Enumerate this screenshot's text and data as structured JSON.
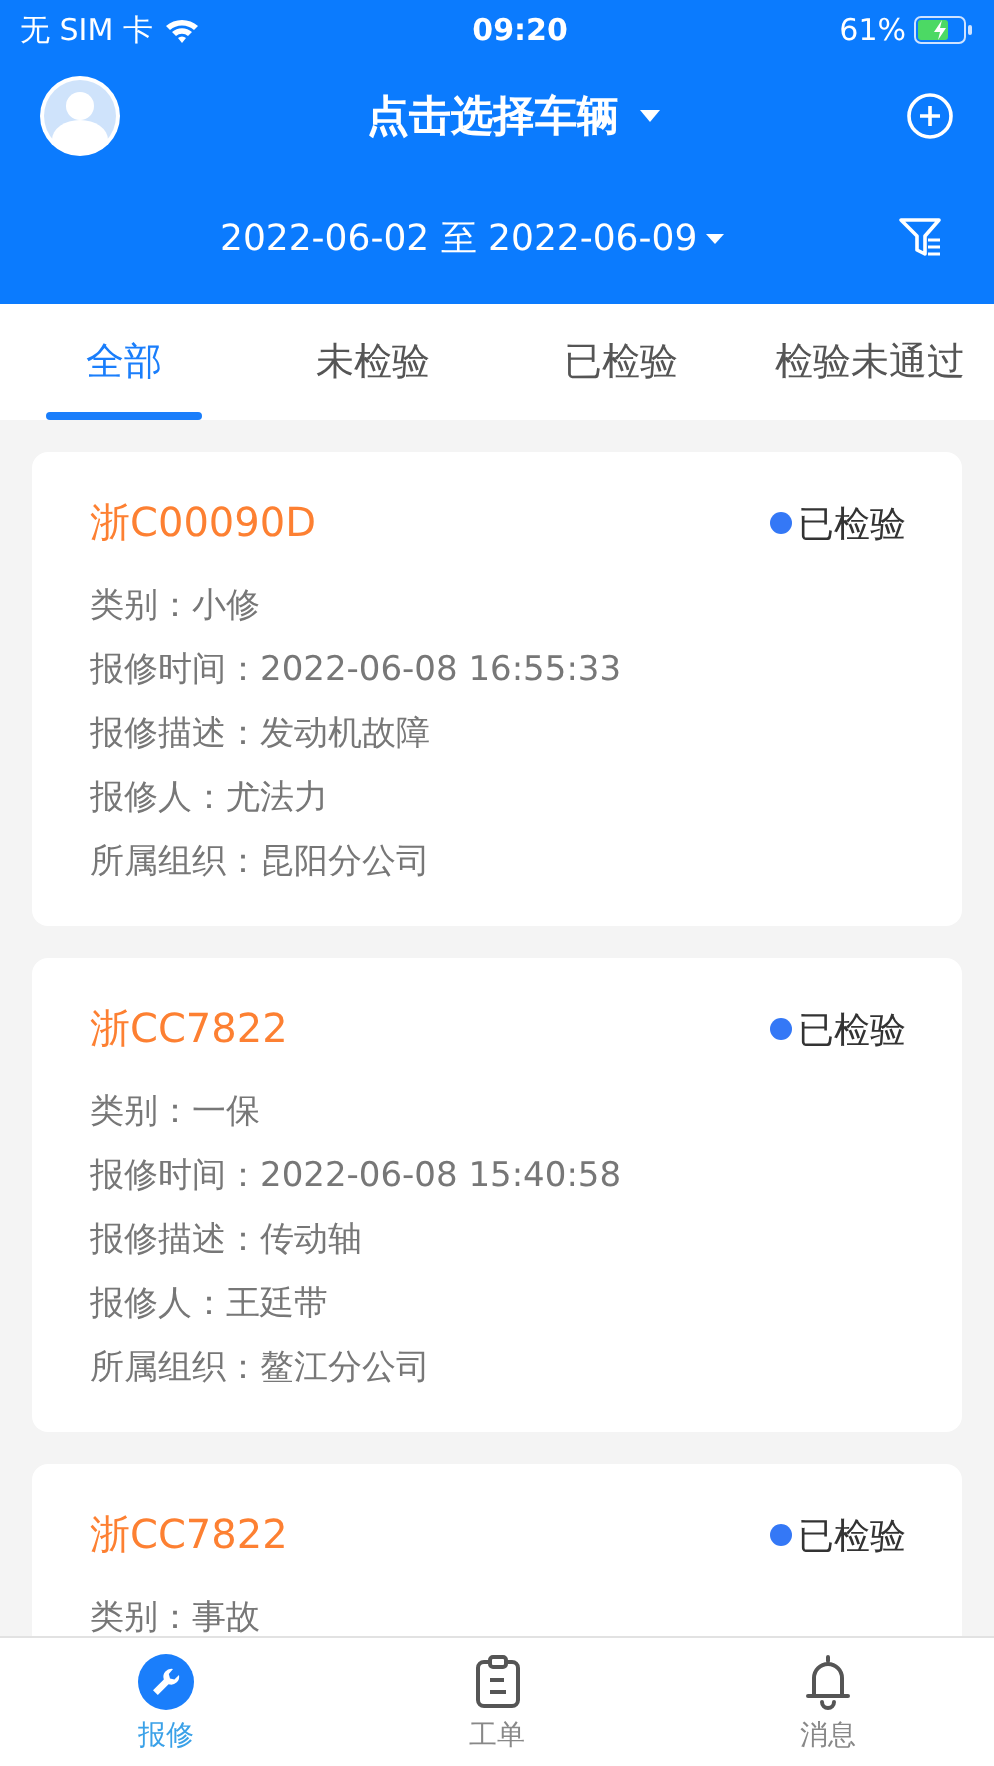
{
  "status_bar": {
    "carrier": "无 SIM 卡",
    "time": "09:20",
    "battery": "61%"
  },
  "header": {
    "title": "点击选择车辆",
    "date_range": "2022-06-02 至 2022-06-09"
  },
  "tabs": [
    {
      "label": "全部",
      "selected": true
    },
    {
      "label": "未检验",
      "selected": false
    },
    {
      "label": "已检验",
      "selected": false
    },
    {
      "label": "检验未通过",
      "selected": false
    }
  ],
  "records": [
    {
      "plate": "浙C00090D",
      "status": "已检验",
      "color": "#3478f6",
      "lines": [
        "类别：小修",
        "报修时间：2022-06-08 16:55:33",
        "报修描述：发动机故障",
        "报修人：尤法力",
        "所属组织：昆阳分公司"
      ]
    },
    {
      "plate": "浙CC7822",
      "status": "已检验",
      "color": "#3478f6",
      "lines": [
        "类别：一保",
        "报修时间：2022-06-08 15:40:58",
        "报修描述：传动轴",
        "报修人：王廷带",
        "所属组织：鳌江分公司"
      ]
    },
    {
      "plate": "浙CC7822",
      "status": "已检验",
      "color": "#3478f6",
      "lines": [
        "类别：事故"
      ]
    }
  ],
  "nav": [
    {
      "label": "报修",
      "kind": "wrench",
      "selected": true
    },
    {
      "label": "工单",
      "kind": "clipboard",
      "selected": false
    },
    {
      "label": "消息",
      "kind": "bell",
      "selected": false
    }
  ]
}
